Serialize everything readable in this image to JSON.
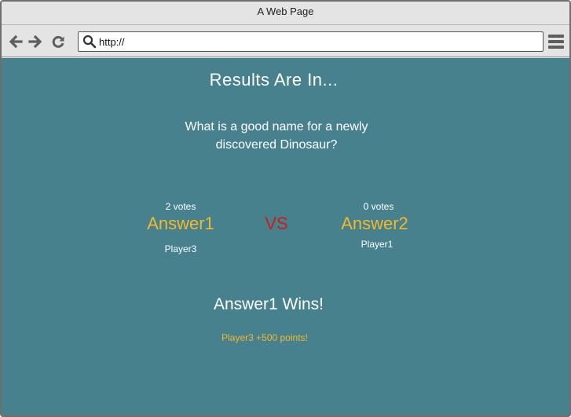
{
  "window": {
    "title": "A Web Page"
  },
  "toolbar": {
    "back_icon": "arrow-left-icon",
    "forward_icon": "arrow-right-icon",
    "reload_icon": "reload-icon",
    "search_icon": "search-icon",
    "menu_icon": "hamburger-menu-icon",
    "url": "http://"
  },
  "content": {
    "heading": "Results Are In...",
    "question": "What is a good name for a newly discovered Dinosaur?",
    "left": {
      "votes": "2 votes",
      "answer": "Answer1",
      "player": "Player3"
    },
    "vs": "VS",
    "right": {
      "votes": "0 votes",
      "answer": "Answer2",
      "player": "Player1"
    },
    "winner": "Answer1 Wins!",
    "points": "Player3  +500 points!"
  },
  "colors": {
    "background": "#47818e",
    "answer": "#f2b92c",
    "vs": "#cf1a1a",
    "text": "#ffffff"
  }
}
